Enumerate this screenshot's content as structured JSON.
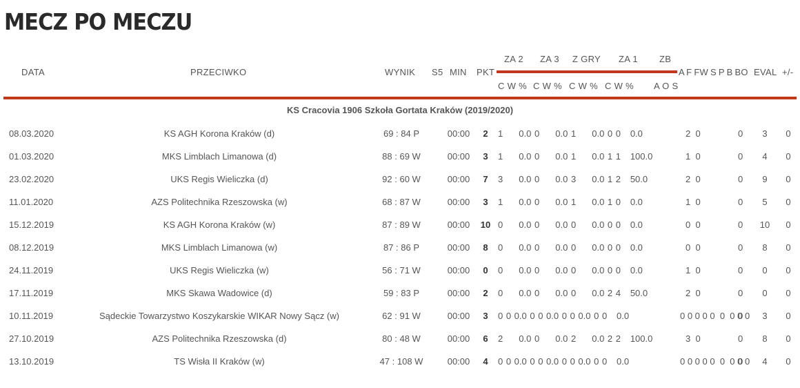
{
  "page_title": "MECZ PO MECZU",
  "headers": {
    "data": "DATA",
    "przeciwko": "PRZECIWKO",
    "wynik": "WYNIK",
    "s5": "S5",
    "min": "MIN",
    "pkt": "PKT",
    "za2": "ZA 2",
    "za3": "ZA 3",
    "zgry": "Z GRY",
    "za1": "ZA 1",
    "zb": "ZB",
    "sub_za2": "C W %",
    "sub_za3": "C W %",
    "sub_zgry": "C W %",
    "sub_za1": "C W %",
    "sub_zb": "A O S",
    "afrest": "A F FW S P B BO",
    "eval": "EVAL",
    "pm": "+/-"
  },
  "team_season": "KS Cracovia 1906 Szkoła Gortata Kraków (2019/2020)",
  "rows": [
    {
      "date": "08.03.2020",
      "opponent": "KS AGH Korona Kraków (d)",
      "result": "69 : 84 P",
      "min": "00:00",
      "pkt": "2",
      "stats": "1     0.0 0     0.0 1     0.0 0 0   0.0",
      "afrest": "2  0",
      "bo": "0",
      "eval": "3",
      "pm": "0"
    },
    {
      "date": "01.03.2020",
      "opponent": "MKS Limblach Limanowa (d)",
      "result": "88 : 69 W",
      "min": "00:00",
      "pkt": "3",
      "stats": "1     0.0 0     0.0 1     0.0 1 1   100.0",
      "afrest": "1  0",
      "bo": "0",
      "eval": "4",
      "pm": "0"
    },
    {
      "date": "23.02.2020",
      "opponent": "UKS Regis Wieliczka (d)",
      "result": "92 : 60 W",
      "min": "00:00",
      "pkt": "7",
      "stats": "3     0.0 0     0.0 3     0.0 1 2   50.0",
      "afrest": "2  0",
      "bo": "0",
      "eval": "9",
      "pm": "0"
    },
    {
      "date": "11.01.2020",
      "opponent": "AZS Politechnika Rzeszowska (w)",
      "result": "68 : 87 W",
      "min": "00:00",
      "pkt": "3",
      "stats": "1     0.0 0     0.0 1     0.0 1 0   0.0",
      "afrest": "1  0",
      "bo": "0",
      "eval": "5",
      "pm": "0"
    },
    {
      "date": "15.12.2019",
      "opponent": "KS AGH Korona Kraków (w)",
      "result": "87 : 89 W",
      "min": "00:00",
      "pkt": "10",
      "stats": "0     0.0 0     0.0 0     0.0 0 0   0.0",
      "afrest": "0  0",
      "bo": "0",
      "eval": "10",
      "pm": "0"
    },
    {
      "date": "08.12.2019",
      "opponent": "MKS Limblach Limanowa (w)",
      "result": "87 : 86 P",
      "min": "00:00",
      "pkt": "8",
      "stats": "0     0.0 0     0.0 0     0.0 0 0   0.0",
      "afrest": "0  0",
      "bo": "0",
      "eval": "8",
      "pm": "0"
    },
    {
      "date": "24.11.2019",
      "opponent": "UKS Regis Wieliczka (w)",
      "result": "56 : 71 W",
      "min": "00:00",
      "pkt": "0",
      "stats": "0     0.0 0     0.0 0     0.0 0 0   0.0",
      "afrest": "1  0",
      "bo": "0",
      "eval": "0",
      "pm": "0"
    },
    {
      "date": "17.11.2019",
      "opponent": "MKS Skawa Wadowice (d)",
      "result": "59 : 83 P",
      "min": "00:00",
      "pkt": "2",
      "stats": "0     0.0 0     0.0 0     0.0 2 4   50.0",
      "afrest": "2  0",
      "bo": "0",
      "eval": "0",
      "pm": "0"
    },
    {
      "date": "10.11.2019",
      "opponent": "Sądeckie Towarzystwo Koszykarskie WIKAR Nowy Sącz (w)",
      "result": "62 : 91 W",
      "min": "00:00",
      "pkt": "3",
      "stats": "0 0 0.0 0 0 0.0 0 0 0.0 0 0   0.0",
      "afrest": "0 0 0 0 0  0  0 0 0",
      "bo": "0",
      "eval": "3",
      "pm": "0"
    },
    {
      "date": "27.10.2019",
      "opponent": "AZS Politechnika Rzeszowska (d)",
      "result": "80 : 48 W",
      "min": "00:00",
      "pkt": "6",
      "stats": "2     0.0 0     0.0 2     0.0 2 2   100.0",
      "afrest": "3  0",
      "bo": "0",
      "eval": "8",
      "pm": "0"
    },
    {
      "date": "13.10.2019",
      "opponent": "TS Wisła II Kraków (w)",
      "result": "47 : 108 W",
      "min": "00:00",
      "pkt": "4",
      "stats": "0 0 0.0 0 0 0.0 0 0 0.0 0 0   0.0",
      "afrest": "0 0 0 0 0  0  0 0 0",
      "bo": "0",
      "eval": "4",
      "pm": "0"
    }
  ]
}
